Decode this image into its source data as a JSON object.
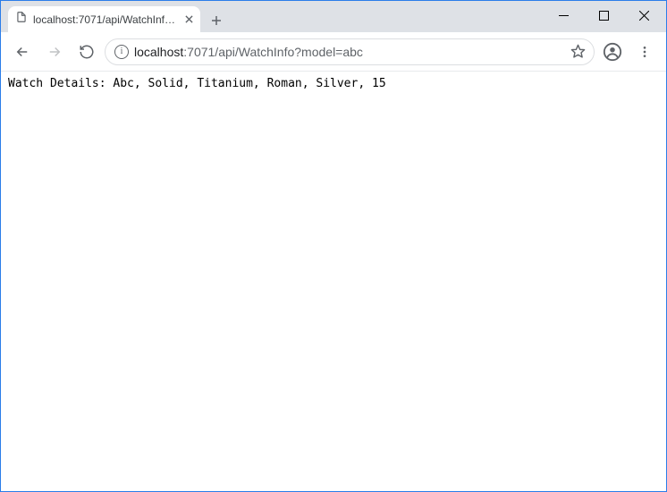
{
  "window": {
    "minimize_label": "Minimize",
    "maximize_label": "Maximize",
    "close_label": "Close"
  },
  "tab": {
    "title": "localhost:7071/api/WatchInfo?model=abc",
    "close_label": "Close tab"
  },
  "toolbar": {
    "back_label": "Back",
    "forward_label": "Forward",
    "reload_label": "Reload",
    "newtab_label": "New tab",
    "bookmark_label": "Bookmark",
    "profile_label": "Profile",
    "menu_label": "Customize and control"
  },
  "address": {
    "info_label": "Site information",
    "url_host": "localhost",
    "url_rest": ":7071/api/WatchInfo?model=abc"
  },
  "page": {
    "body_text": "Watch Details: Abc, Solid, Titanium, Roman, Silver, 15"
  }
}
